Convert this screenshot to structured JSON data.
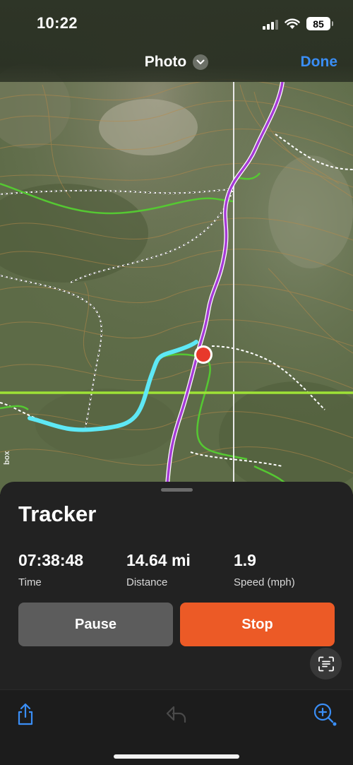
{
  "status_bar": {
    "time": "10:22",
    "battery": "85"
  },
  "nav": {
    "title": "Photo",
    "done_label": "Done"
  },
  "map": {
    "attribution": "box"
  },
  "tracker": {
    "title": "Tracker",
    "stats": [
      {
        "value": "07:38:48",
        "label": "Time"
      },
      {
        "value": "14.64 mi",
        "label": "Distance"
      },
      {
        "value": "1.9",
        "label": "Speed (mph)"
      }
    ],
    "pause_label": "Pause",
    "stop_label": "Stop"
  },
  "colors": {
    "accent_blue": "#3a8ef6",
    "stop_orange": "#ec5a26",
    "track_cyan": "#5ee8f5",
    "route_purple": "#a63bd6",
    "trail_green": "#55c832",
    "location_red": "#e8392b"
  },
  "icons": {
    "share": "share-icon",
    "undo": "undo-icon",
    "zoom": "zoom-add-icon",
    "scan": "scan-text-icon",
    "chevron": "chevron-down-icon"
  }
}
